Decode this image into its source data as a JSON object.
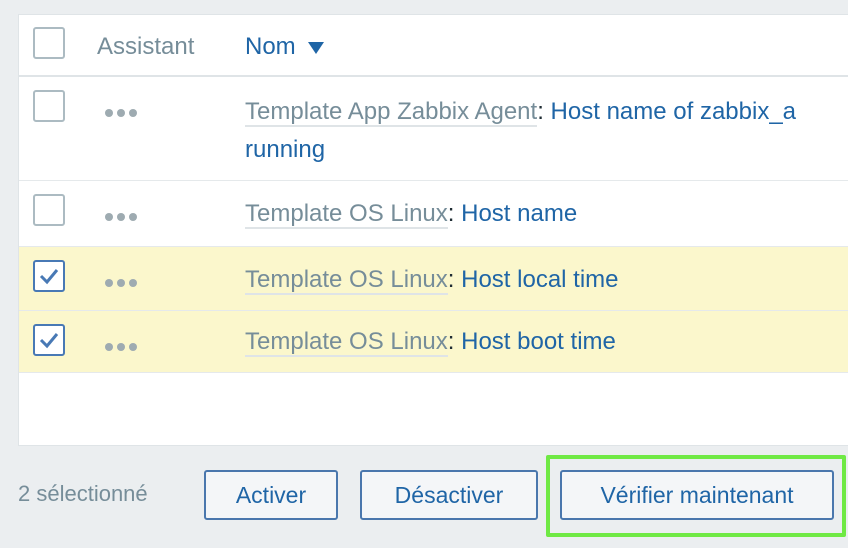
{
  "table": {
    "header": {
      "assistant_label": "Assistant",
      "name_label": "Nom"
    },
    "rows": [
      {
        "template": "Template App Zabbix Agent",
        "separator": ":",
        "item": "Host name of zabbix_a",
        "item_line2": "running",
        "checked": false
      },
      {
        "template": "Template OS Linux",
        "separator": ":",
        "item": "Host name",
        "checked": false
      },
      {
        "template": "Template OS Linux",
        "separator": ":",
        "item": "Host local time",
        "checked": true
      },
      {
        "template": "Template OS Linux",
        "separator": ":",
        "item": "Host boot time",
        "checked": true
      }
    ]
  },
  "footer": {
    "selected_count": "2 sélectionné",
    "activate_label": "Activer",
    "deactivate_label": "Désactiver",
    "check_now_label": "Vérifier maintenant"
  },
  "colors": {
    "link": "#1f65a6",
    "selected_row": "#fbf7cc",
    "highlight": "#6fe944"
  }
}
